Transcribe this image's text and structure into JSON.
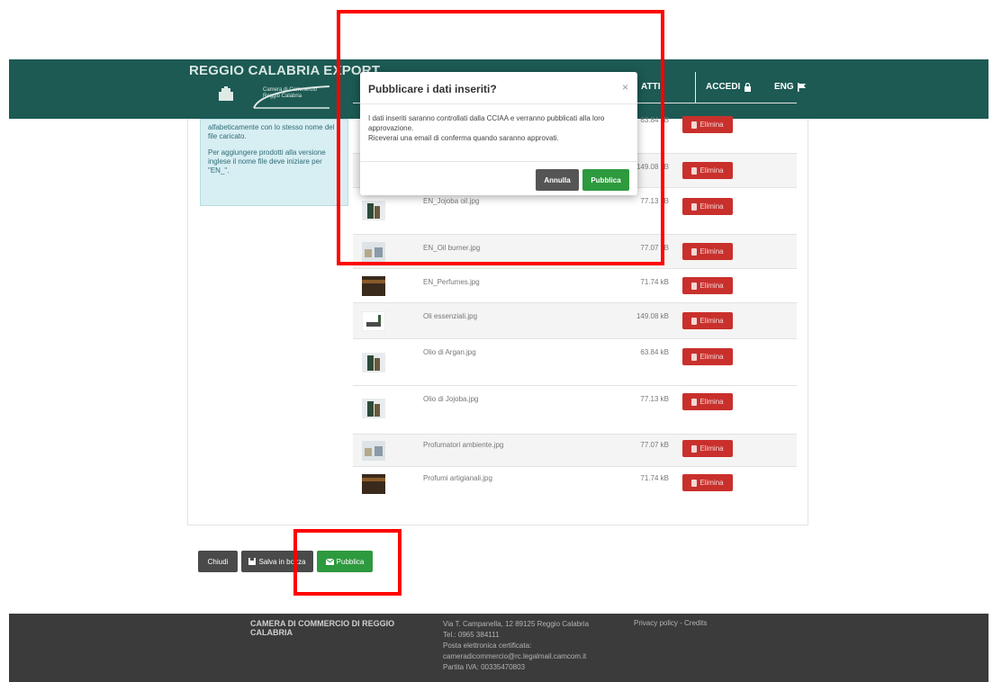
{
  "header": {
    "brand_title": "REGGIO CALABRIA EXPORT",
    "logo_text": "Camera di Commercio Reggio Calabria",
    "nav_partial": "ATTI",
    "accedi": "ACCEDI",
    "eng": "ENG",
    "color": "#1c5a53"
  },
  "info_panel": {
    "line1": "alfabeticamente con lo stesso nome del file caricato.",
    "line2": "Per aggiungere prodotti alla versione inglese il nome file deve iniziare per \"EN_\"."
  },
  "files": [
    {
      "name": "",
      "size": "63.84 kB",
      "delete": "Elimina"
    },
    {
      "name": "",
      "size": "149.08 kB",
      "delete": "Elimina"
    },
    {
      "name": "EN_Jojoba oil.jpg",
      "size": "77.13 kB",
      "delete": "Elimina"
    },
    {
      "name": "EN_Oil burner.jpg",
      "size": "77.07 kB",
      "delete": "Elimina"
    },
    {
      "name": "EN_Perfumes.jpg",
      "size": "71.74 kB",
      "delete": "Elimina"
    },
    {
      "name": "Oli essenziali.jpg",
      "size": "149.08 kB",
      "delete": "Elimina"
    },
    {
      "name": "Olio di Argan.jpg",
      "size": "63.84 kB",
      "delete": "Elimina"
    },
    {
      "name": "Olio di Jojoba.jpg",
      "size": "77.13 kB",
      "delete": "Elimina"
    },
    {
      "name": "Profumatori ambiente.jpg",
      "size": "77.07 kB",
      "delete": "Elimina"
    },
    {
      "name": "Profumi artigianali.jpg",
      "size": "71.74 kB",
      "delete": "Elimina"
    }
  ],
  "actions": {
    "chiudi": "Chiudi",
    "salva": "Salva in bozza",
    "pubblica": "Pubblica"
  },
  "modal": {
    "title": "Pubblicare i dati inseriti?",
    "close": "×",
    "body_line1": "I dati inseriti saranno controllati dalla CCIAA e verranno pubblicati alla loro approvazione.",
    "body_line2": "Riceverai una email di conferma quando saranno approvati.",
    "annulla": "Annulla",
    "pubblica": "Pubblica"
  },
  "footer": {
    "name": "CAMERA DI COMMERCIO DI REGGIO CALABRIA",
    "address": "Via T. Campanella, 12 89125 Reggio Calabria",
    "tel": "Tel.: 0965 384111",
    "pec_label": "Posta elettronica certificata:",
    "pec": "cameradicommercio@rc.legalmail.camcom.it",
    "piva": "Partita IVA: 00335470803",
    "links": "Privacy policy - Credits"
  },
  "colors": {
    "annotation": "#ff0000",
    "delete": "#c9302c",
    "publish": "#2d9a3e"
  }
}
